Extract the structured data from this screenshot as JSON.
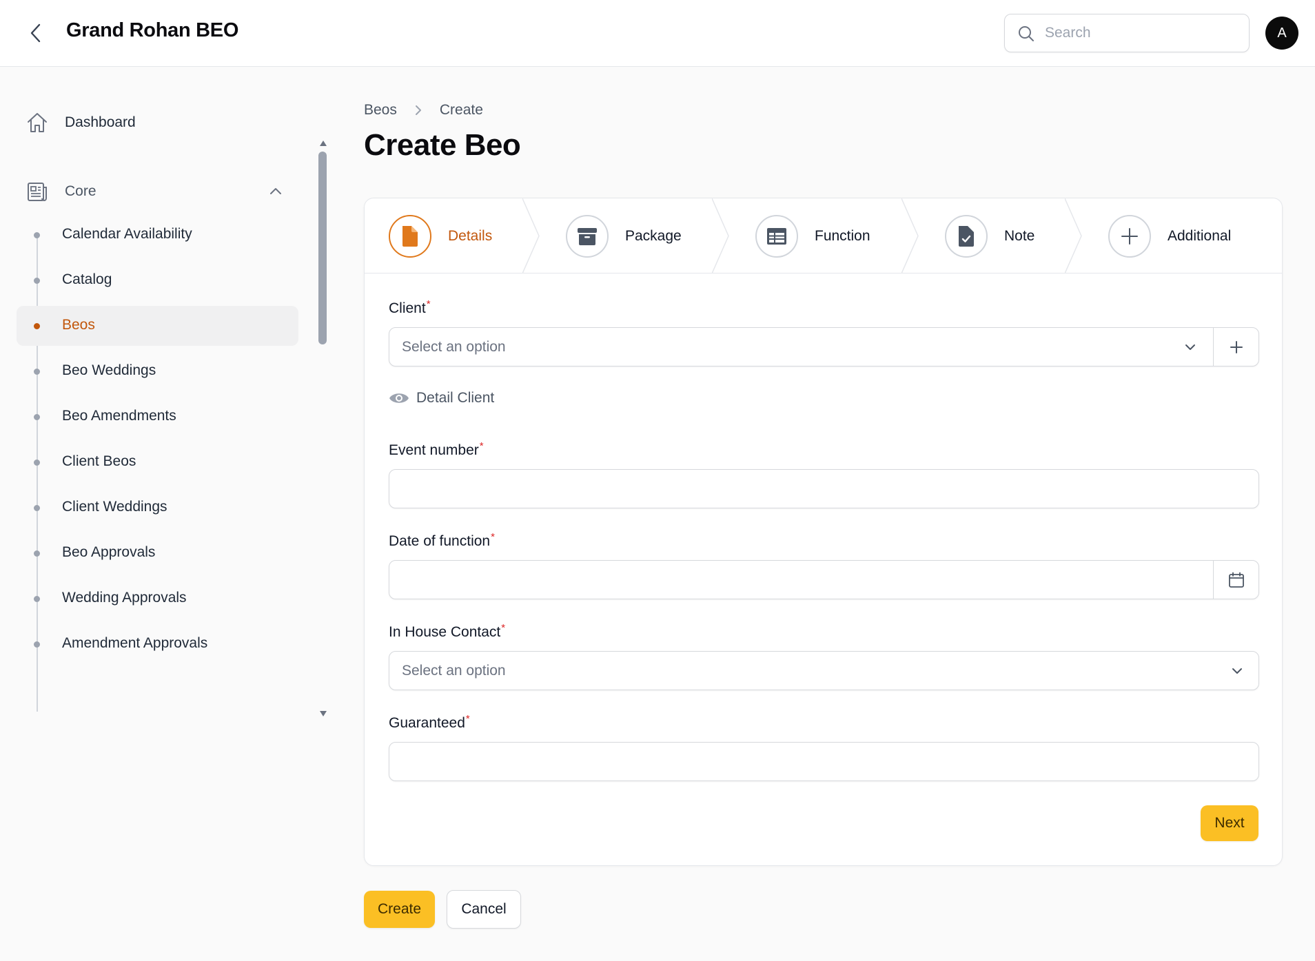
{
  "header": {
    "title": "Grand Rohan BEO",
    "search_placeholder": "Search",
    "avatar_initial": "A",
    "back_icon": "chevron-left-icon"
  },
  "sidebar": {
    "dashboard_label": "Dashboard",
    "group_label": "Core",
    "group_expanded": true,
    "items": [
      {
        "label": "Calendar Availability",
        "active": false
      },
      {
        "label": "Catalog",
        "active": false
      },
      {
        "label": "Beos",
        "active": true
      },
      {
        "label": "Beo Weddings",
        "active": false
      },
      {
        "label": "Beo Amendments",
        "active": false
      },
      {
        "label": "Client Beos",
        "active": false
      },
      {
        "label": "Client Weddings",
        "active": false
      },
      {
        "label": "Beo Approvals",
        "active": false
      },
      {
        "label": "Wedding Approvals",
        "active": false
      },
      {
        "label": "Amendment Approvals",
        "active": false
      }
    ]
  },
  "breadcrumb": [
    "Beos",
    "Create"
  ],
  "page_title": "Create Beo",
  "steps": [
    {
      "label": "Details",
      "icon": "document-icon",
      "active": true
    },
    {
      "label": "Package",
      "icon": "archive-box-icon",
      "active": false
    },
    {
      "label": "Function",
      "icon": "table-icon",
      "active": false
    },
    {
      "label": "Note",
      "icon": "document-check-icon",
      "active": false
    },
    {
      "label": "Additional",
      "icon": "plus-icon",
      "active": false
    }
  ],
  "form": {
    "client": {
      "label": "Client",
      "placeholder": "Select an option",
      "required": true
    },
    "detail_client_label": "Detail Client",
    "event_number": {
      "label": "Event number",
      "value": "",
      "required": true
    },
    "date_of_function": {
      "label": "Date of function",
      "value": "",
      "required": true
    },
    "in_house_contact": {
      "label": "In House Contact",
      "placeholder": "Select an option",
      "required": true
    },
    "guaranteed": {
      "label": "Guaranteed",
      "value": "",
      "required": true
    },
    "required_marker": "*"
  },
  "buttons": {
    "next": "Next",
    "create": "Create",
    "cancel": "Cancel"
  },
  "colors": {
    "accent": "#c2570c",
    "primary_button": "#fbbf24",
    "required": "#dc2626"
  }
}
